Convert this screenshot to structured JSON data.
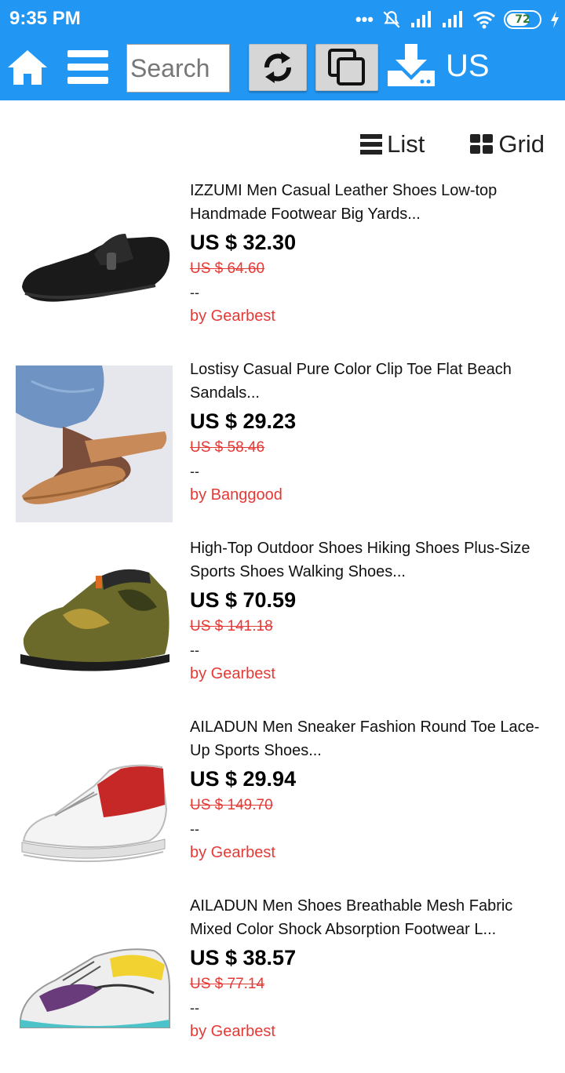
{
  "status": {
    "time": "9:35 PM",
    "battery": "72",
    "battery_level": 0.72
  },
  "toolbar": {
    "search_placeholder": "Search",
    "region": "US",
    "icons": [
      "home-icon",
      "menu-icon",
      "refresh-icon",
      "copy-icon",
      "download-icon"
    ]
  },
  "view": {
    "list_label": "List",
    "grid_label": "Grid"
  },
  "products": [
    {
      "title": "IZZUMI Men Casual Leather Shoes Low-top Handmade Footwear Big Yards...",
      "price": "US $ 32.30",
      "old_price": "US $ 64.60",
      "rating": "--",
      "seller": "by Gearbest"
    },
    {
      "title": "Lostisy Casual Pure Color Clip Toe Flat Beach Sandals...",
      "price": "US $ 29.23",
      "old_price": "US $ 58.46",
      "rating": "--",
      "seller": "by Banggood"
    },
    {
      "title": "High-Top Outdoor Shoes Hiking Shoes Plus-Size Sports Shoes Walking Shoes...",
      "price": "US $ 70.59",
      "old_price": "US $ 141.18",
      "rating": "--",
      "seller": "by Gearbest"
    },
    {
      "title": "AILADUN Men Sneaker Fashion Round Toe Lace-Up Sports Shoes...",
      "price": "US $ 29.94",
      "old_price": "US $ 149.70",
      "rating": "--",
      "seller": "by Gearbest"
    },
    {
      "title": "AILADUN Men Shoes Breathable Mesh Fabric Mixed Color Shock Absorption Footwear L...",
      "price": "US $ 38.57",
      "old_price": "US $ 77.14",
      "rating": "--",
      "seller": "by Gearbest"
    }
  ],
  "colors": {
    "accent": "#2196f3",
    "sale": "#e53935",
    "button": "#d6d6d6"
  }
}
